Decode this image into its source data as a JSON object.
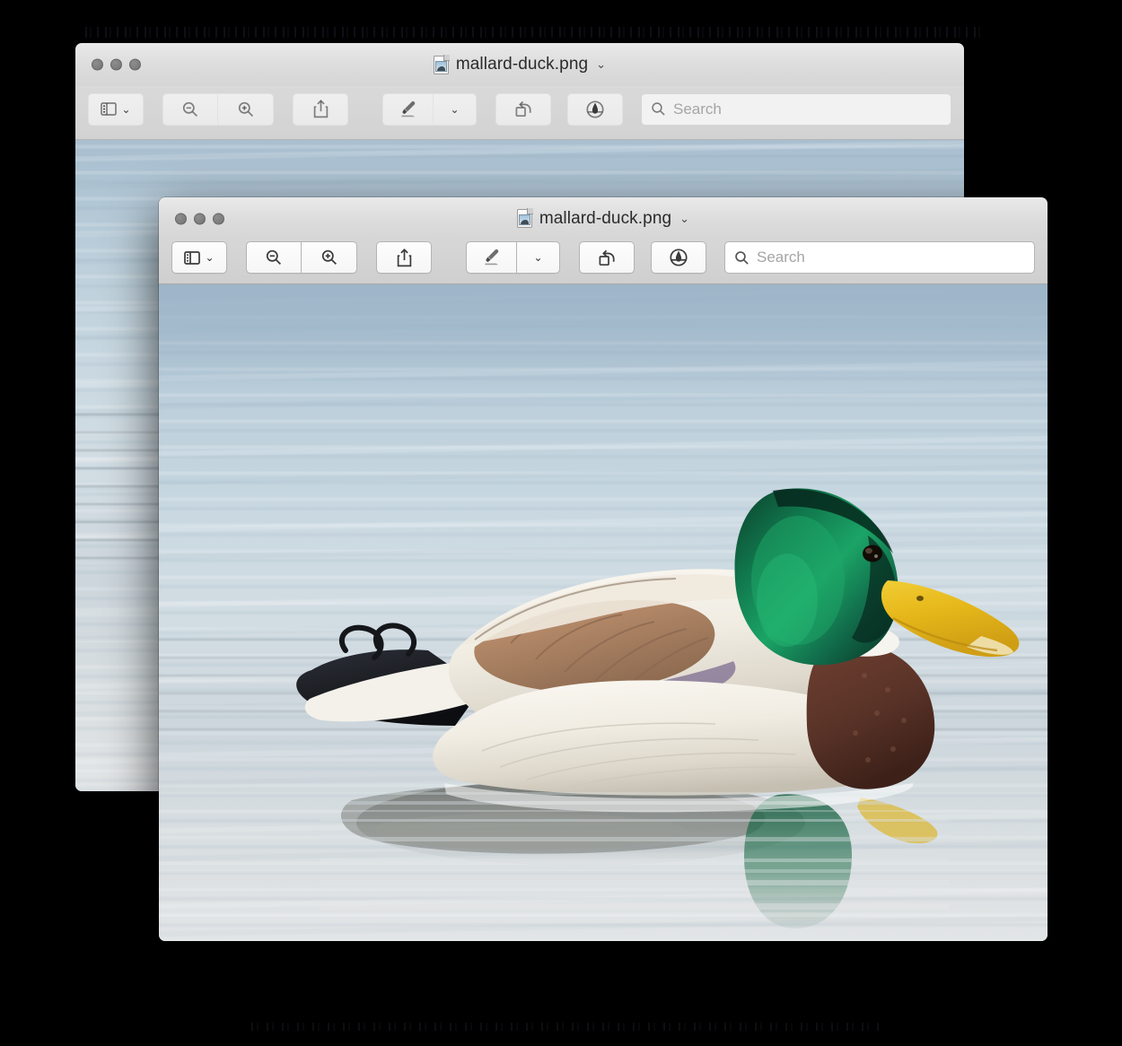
{
  "desktop": {
    "background_color": "#000000"
  },
  "windows": [
    {
      "id": "background-window",
      "title": "mallard-duck.png",
      "title_chevron": "⌄",
      "state": "inactive",
      "traffic_lights": [
        "close",
        "minimize",
        "zoom"
      ],
      "toolbar": {
        "sidebar_button": {
          "icon": "sidebar-icon",
          "chevron": "⌄"
        },
        "zoom_out_button": {
          "icon": "zoom-out-icon"
        },
        "zoom_in_button": {
          "icon": "zoom-in-icon"
        },
        "share_button": {
          "icon": "share-icon"
        },
        "markup_pen_button": {
          "icon": "highlighter-pen-icon",
          "chevron": "⌄"
        },
        "rotate_button": {
          "icon": "rotate-left-icon"
        },
        "annotate_button": {
          "icon": "markup-nib-icon"
        },
        "search": {
          "icon": "search-icon",
          "placeholder": "Search",
          "value": ""
        }
      }
    },
    {
      "id": "foreground-window",
      "title": "mallard-duck.png",
      "title_chevron": "⌄",
      "state": "active",
      "traffic_lights": [
        "close",
        "minimize",
        "zoom"
      ],
      "toolbar": {
        "sidebar_button": {
          "icon": "sidebar-icon",
          "chevron": "⌄"
        },
        "zoom_out_button": {
          "icon": "zoom-out-icon"
        },
        "zoom_in_button": {
          "icon": "zoom-in-icon"
        },
        "share_button": {
          "icon": "share-icon"
        },
        "markup_pen_button": {
          "icon": "highlighter-pen-icon",
          "chevron": "⌄"
        },
        "rotate_button": {
          "icon": "rotate-left-icon"
        },
        "annotate_button": {
          "icon": "markup-nib-icon"
        },
        "search": {
          "icon": "search-icon",
          "placeholder": "Search",
          "value": ""
        }
      }
    }
  ],
  "photo": {
    "subject": "mallard duck swimming on water",
    "colors": {
      "water_top": "#a9bfd0",
      "water_mid": "#cfdbe2",
      "water_bottom": "#e2e5e6",
      "head_green": "#0f6b46",
      "head_green_highlight": "#1d9c5e",
      "bill_yellow": "#e8b81b",
      "breast_brown": "#5a3328",
      "body_white": "#f2efe8",
      "tail_black": "#1b1d22",
      "wing_tan": "#b08666"
    }
  }
}
